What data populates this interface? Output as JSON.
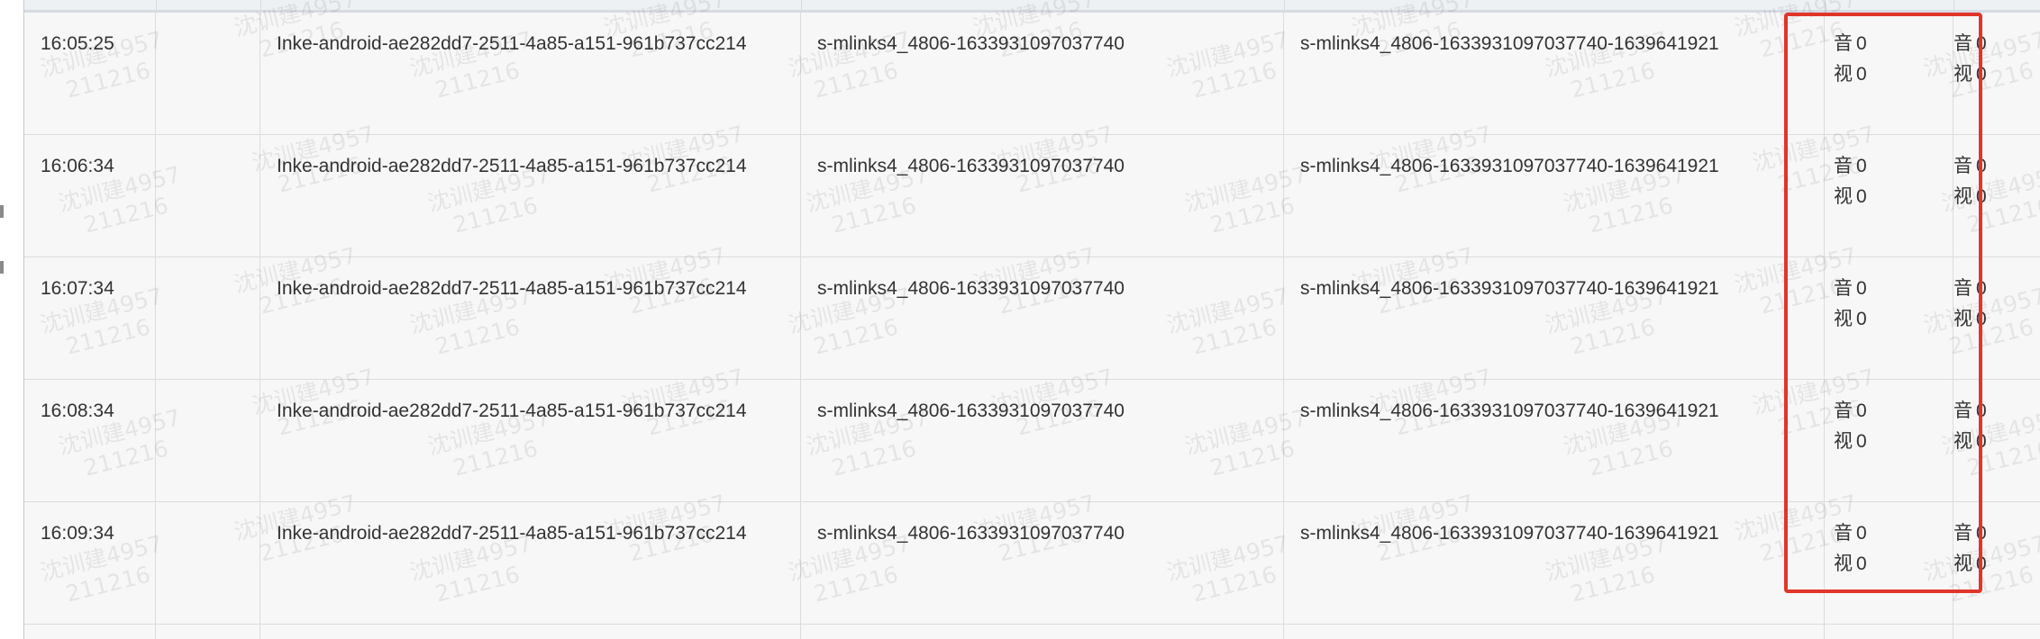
{
  "table": {
    "rows": [
      {
        "time": "16:05:25",
        "client_id": "Inke-android-ae282dd7-2511-4a85-a151-961b737cc214",
        "stream": "s-mlinks4_4806-1633931097037740",
        "session": "s-mlinks4_4806-1633931097037740-1639641921",
        "av_left": {
          "audio_label": "音",
          "audio_value": "0",
          "video_label": "视",
          "video_value": "0"
        },
        "av_right": {
          "audio_label": "音",
          "audio_value": "0",
          "video_label": "视",
          "video_value": "0"
        }
      },
      {
        "time": "16:06:34",
        "client_id": "Inke-android-ae282dd7-2511-4a85-a151-961b737cc214",
        "stream": "s-mlinks4_4806-1633931097037740",
        "session": "s-mlinks4_4806-1633931097037740-1639641921",
        "av_left": {
          "audio_label": "音",
          "audio_value": "0",
          "video_label": "视",
          "video_value": "0"
        },
        "av_right": {
          "audio_label": "音",
          "audio_value": "0",
          "video_label": "视",
          "video_value": "0"
        }
      },
      {
        "time": "16:07:34",
        "client_id": "Inke-android-ae282dd7-2511-4a85-a151-961b737cc214",
        "stream": "s-mlinks4_4806-1633931097037740",
        "session": "s-mlinks4_4806-1633931097037740-1639641921",
        "av_left": {
          "audio_label": "音",
          "audio_value": "0",
          "video_label": "视",
          "video_value": "0"
        },
        "av_right": {
          "audio_label": "音",
          "audio_value": "0",
          "video_label": "视",
          "video_value": "0"
        }
      },
      {
        "time": "16:08:34",
        "client_id": "Inke-android-ae282dd7-2511-4a85-a151-961b737cc214",
        "stream": "s-mlinks4_4806-1633931097037740",
        "session": "s-mlinks4_4806-1633931097037740-1639641921",
        "av_left": {
          "audio_label": "音",
          "audio_value": "0",
          "video_label": "视",
          "video_value": "0"
        },
        "av_right": {
          "audio_label": "音",
          "audio_value": "0",
          "video_label": "视",
          "video_value": "0"
        }
      },
      {
        "time": "16:09:34",
        "client_id": "Inke-android-ae282dd7-2511-4a85-a151-961b737cc214",
        "stream": "s-mlinks4_4806-1633931097037740",
        "session": "s-mlinks4_4806-1633931097037740-1639641921",
        "av_left": {
          "audio_label": "音",
          "audio_value": "0",
          "video_label": "视",
          "video_value": "0"
        },
        "av_right": {
          "audio_label": "音",
          "audio_value": "0",
          "video_label": "视",
          "video_value": "0"
        }
      }
    ]
  },
  "watermark": {
    "line1": "沈训建4957",
    "line2": "211216"
  },
  "colors": {
    "row_background": "#f7f7f7",
    "grid_line": "#dcdcdc",
    "text": "#333333",
    "highlight": "#e0362a"
  }
}
